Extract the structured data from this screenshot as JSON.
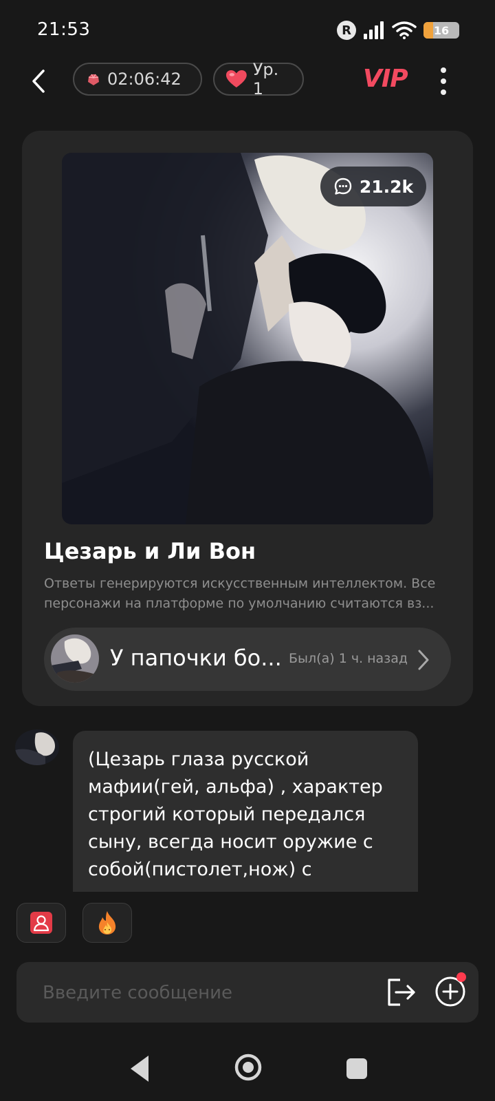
{
  "status_bar": {
    "time": "21:53",
    "r_badge": "R",
    "battery_level": "16",
    "battery_fraction": 0.16
  },
  "header": {
    "timer": "02:06:42",
    "level": "Ур. 1",
    "vip": "VIP"
  },
  "character": {
    "comments_count": "21.2k",
    "name": "Цезарь и Ли Вон",
    "disclaimer": "Ответы генерируются искусственным интеллектом. Все персонажи на платформе по умолчанию считаются вз..."
  },
  "story": {
    "title": "У папочки бо...",
    "last_seen": "Был(а) 1 ч. назад"
  },
  "message": {
    "text": "(Цезарь глаза русской мафии(гей, альфа) , характер строгий который передался сыну, всегда носит оружие с собой(пистолет,нож) с"
  },
  "composer": {
    "placeholder": "Введите сообщение"
  },
  "colors": {
    "background": "#181818",
    "card": "#262626",
    "vip": "#f24a60",
    "notification_dot": "#ff3b4e",
    "battery": "#f0a23c"
  },
  "icons": [
    "back-arrow-icon",
    "gem-icon",
    "heart-icon",
    "more-vertical-icon",
    "comment-icon",
    "chevron-right-icon",
    "profile-card-icon",
    "fire-icon",
    "exit-icon",
    "plus-circle-icon",
    "nav-back-icon",
    "nav-home-icon",
    "nav-recents-icon"
  ]
}
